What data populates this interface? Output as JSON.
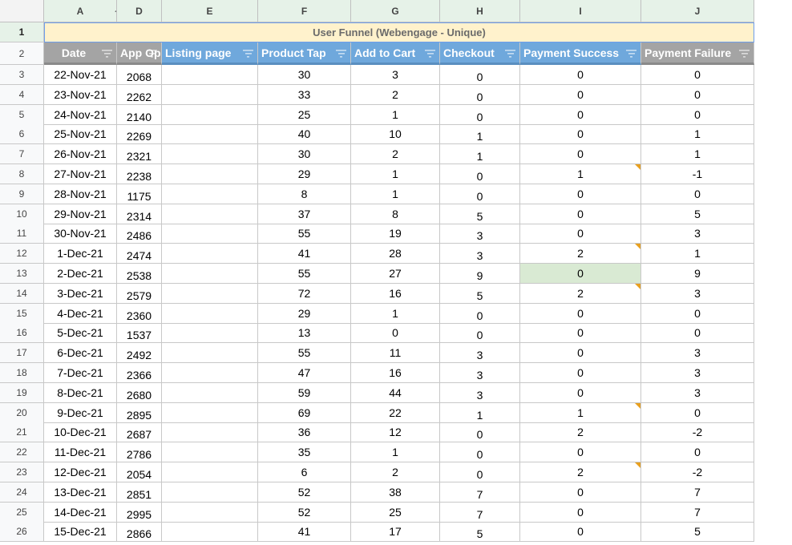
{
  "sheet": {
    "column_letters": [
      "A",
      "D",
      "E",
      "F",
      "G",
      "H",
      "I",
      "J"
    ],
    "title": "User Funnel (Webengage - Unique)",
    "headers": [
      "Date",
      "App Open",
      "Listing page",
      "Product Tap",
      "Add to Cart",
      "Checkout",
      "Payment Success",
      "Payment Failure"
    ],
    "header_colors": {
      "gray": "#a4a4a4",
      "blue": "#6fa8dc",
      "title_bg": "#fff2cc",
      "column_header_bg": "#e6f2e8"
    },
    "rows": [
      {
        "num": "3",
        "cells": [
          "22-Nov-21",
          "2068",
          "",
          "30",
          "3",
          "0",
          "0",
          "0"
        ]
      },
      {
        "num": "4",
        "cells": [
          "23-Nov-21",
          "2262",
          "",
          "33",
          "2",
          "0",
          "0",
          "0"
        ]
      },
      {
        "num": "5",
        "cells": [
          "24-Nov-21",
          "2140",
          "",
          "25",
          "1",
          "0",
          "0",
          "0"
        ]
      },
      {
        "num": "6",
        "cells": [
          "25-Nov-21",
          "2269",
          "",
          "40",
          "10",
          "1",
          "0",
          "1"
        ]
      },
      {
        "num": "7",
        "cells": [
          "26-Nov-21",
          "2321",
          "",
          "30",
          "2",
          "1",
          "0",
          "1"
        ]
      },
      {
        "num": "8",
        "cells": [
          "27-Nov-21",
          "2238",
          "",
          "29",
          "1",
          "0",
          "1",
          "-1"
        ]
      },
      {
        "num": "9",
        "cells": [
          "28-Nov-21",
          "1175",
          "",
          "8",
          "1",
          "0",
          "0",
          "0"
        ]
      },
      {
        "num": "10",
        "cells": [
          "29-Nov-21",
          "2314",
          "",
          "37",
          "8",
          "5",
          "0",
          "5"
        ]
      },
      {
        "num": "11",
        "cells": [
          "30-Nov-21",
          "2486",
          "",
          "55",
          "19",
          "3",
          "0",
          "3"
        ]
      },
      {
        "num": "12",
        "cells": [
          "1-Dec-21",
          "2474",
          "",
          "41",
          "28",
          "3",
          "2",
          "1"
        ]
      },
      {
        "num": "13",
        "cells": [
          "2-Dec-21",
          "2538",
          "",
          "55",
          "27",
          "9",
          "0",
          "9"
        ]
      },
      {
        "num": "14",
        "cells": [
          "3-Dec-21",
          "2579",
          "",
          "72",
          "16",
          "5",
          "2",
          "3"
        ]
      },
      {
        "num": "15",
        "cells": [
          "4-Dec-21",
          "2360",
          "",
          "29",
          "1",
          "0",
          "0",
          "0"
        ]
      },
      {
        "num": "16",
        "cells": [
          "5-Dec-21",
          "1537",
          "",
          "13",
          "0",
          "0",
          "0",
          "0"
        ]
      },
      {
        "num": "17",
        "cells": [
          "6-Dec-21",
          "2492",
          "",
          "55",
          "11",
          "3",
          "0",
          "3"
        ]
      },
      {
        "num": "18",
        "cells": [
          "7-Dec-21",
          "2366",
          "",
          "47",
          "16",
          "3",
          "0",
          "3"
        ]
      },
      {
        "num": "19",
        "cells": [
          "8-Dec-21",
          "2680",
          "",
          "59",
          "44",
          "3",
          "0",
          "3"
        ]
      },
      {
        "num": "20",
        "cells": [
          "9-Dec-21",
          "2895",
          "",
          "69",
          "22",
          "1",
          "1",
          "0"
        ]
      },
      {
        "num": "21",
        "cells": [
          "10-Dec-21",
          "2687",
          "",
          "36",
          "12",
          "0",
          "2",
          "-2"
        ]
      },
      {
        "num": "22",
        "cells": [
          "11-Dec-21",
          "2786",
          "",
          "35",
          "1",
          "0",
          "0",
          "0"
        ]
      },
      {
        "num": "23",
        "cells": [
          "12-Dec-21",
          "2054",
          "",
          "6",
          "2",
          "0",
          "2",
          "-2"
        ]
      },
      {
        "num": "24",
        "cells": [
          "13-Dec-21",
          "2851",
          "",
          "52",
          "38",
          "7",
          "0",
          "7"
        ]
      },
      {
        "num": "25",
        "cells": [
          "14-Dec-21",
          "2995",
          "",
          "52",
          "25",
          "7",
          "0",
          "7"
        ]
      },
      {
        "num": "26",
        "cells": [
          "15-Dec-21",
          "2866",
          "",
          "41",
          "17",
          "5",
          "0",
          "5"
        ]
      }
    ],
    "row1_num": "1",
    "row2_num": "2",
    "comment_cells": [
      "8:6",
      "12:6",
      "14:6",
      "20:6",
      "23:6"
    ],
    "highlighted_cell": "13:6"
  }
}
